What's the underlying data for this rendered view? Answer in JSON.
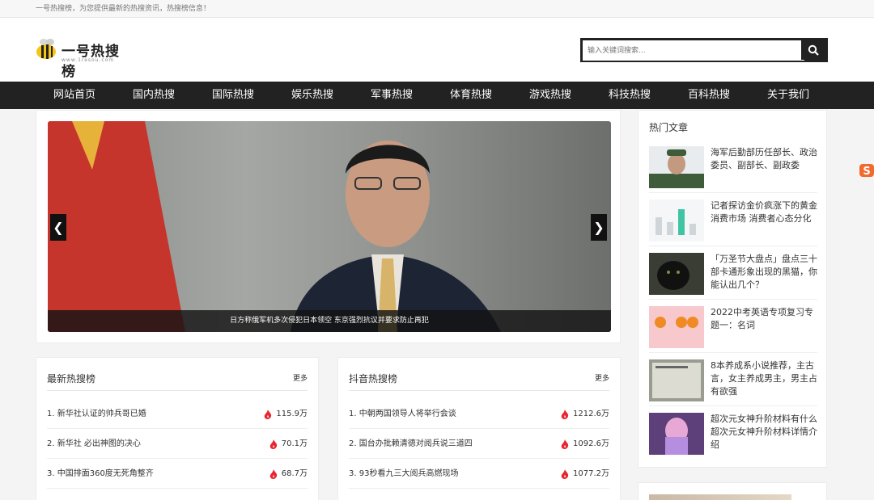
{
  "topbar": {
    "text": "一号热搜榜，为您提供最新的热搜资讯，热搜榜信息！"
  },
  "header": {
    "logo_text": "一号热搜榜",
    "logo_sub": "www.1resou.com",
    "search_placeholder": "输入关键词搜索..."
  },
  "nav": [
    "网站首页",
    "国内热搜",
    "国际热搜",
    "娱乐热搜",
    "军事热搜",
    "体育热搜",
    "游戏热搜",
    "科技热搜",
    "百科热搜",
    "关于我们"
  ],
  "slider": {
    "caption": "日方称俄军机多次侵犯日本领空 东京强烈抗议并要求防止再犯",
    "prev": "❮",
    "next": "❯"
  },
  "sidebar": {
    "title": "热门文章",
    "articles": [
      {
        "title": "海军后勤部历任部长、政治委员、副部长、副政委"
      },
      {
        "title": "记者探访金价疯涨下的黄金消费市场 消费者心态分化"
      },
      {
        "title": "「万圣节大盘点」盘点三十部卡通形象出现的黑猫，你能认出几个？"
      },
      {
        "title": "2022中考英语专项复习专题一：名词"
      },
      {
        "title": "8本养成系小说推荐，主古言，女主养成男主，男主占有欲强"
      },
      {
        "title": "超次元女神升阶材料有什么 超次元女神升阶材料详情介绍"
      }
    ]
  },
  "latest": {
    "title": "最新热搜榜",
    "more": "更多",
    "items": [
      {
        "title": "1. 新华社认证的帅兵哥已婚",
        "hot": "115.9万"
      },
      {
        "title": "2. 新华社 必出神图的决心",
        "hot": "70.1万"
      },
      {
        "title": "3. 中国排面360度无死角整齐",
        "hot": "68.7万"
      }
    ]
  },
  "douyin": {
    "title": "抖音热搜榜",
    "more": "更多",
    "items": [
      {
        "title": "1. 中朝两国领导人将举行会谈",
        "hot": "1212.6万"
      },
      {
        "title": "2. 国台办批赖清德对阅兵说三道四",
        "hot": "1092.6万"
      },
      {
        "title": "3. 93秒看九三大阅兵高燃现场",
        "hot": "1077.2万"
      }
    ]
  },
  "colors": {
    "nav_bg": "#222222",
    "hot_icon": "#e8262f",
    "accent": "#f5c518"
  }
}
